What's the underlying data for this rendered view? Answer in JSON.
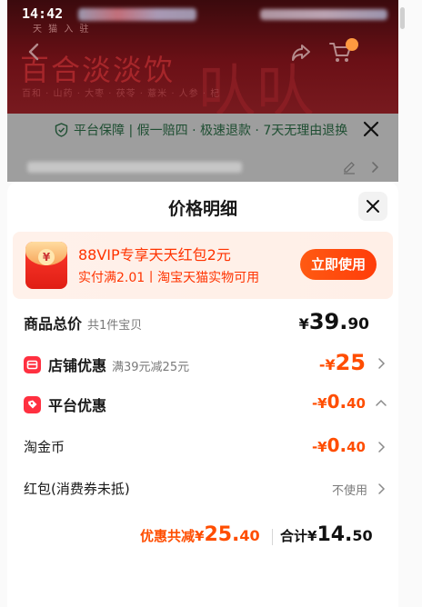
{
  "status_bar": {
    "time": "14:42"
  },
  "background": {
    "title": "百合淡淡饮",
    "top_text": "天 猫 入 驻",
    "subtitle": "百和 · 山药 · 大枣 · 茯苓 · 薏米 · 人参 · 杞",
    "guarantee_text": "平台保障 | 假一赔四 · 极速退款 · 7天无理由退换",
    "colors": {
      "hero": "#6b1016",
      "guarantee_text": "#1e4e32"
    }
  },
  "sheet": {
    "title": "价格明细",
    "promo": {
      "title": "88VIP专享天天红包2元",
      "subtitle": "实付满2.01丨淘宝天猫实物可用",
      "button": "立即使用",
      "icon_symbol": "¥"
    },
    "rows": {
      "total": {
        "label": "商品总价",
        "note": "共1件宝贝",
        "currency": "¥",
        "integer": "39.",
        "decimal": "90"
      },
      "shop_discount": {
        "label": "店铺优惠",
        "note": "满39元减25元",
        "prefix": "-¥",
        "integer": "25"
      },
      "platform_discount": {
        "label": "平台优惠",
        "prefix": "-¥",
        "integer": "0.",
        "decimal": "40"
      },
      "taojinbi": {
        "label": "淘金币",
        "prefix": "-¥",
        "integer": "0.",
        "decimal": "40"
      },
      "hongbao": {
        "label": "红包(消费券未抵)",
        "value": "不使用"
      }
    },
    "summary": {
      "discount_label": "优惠共减¥",
      "discount_integer": "25.",
      "discount_decimal": "40",
      "total_label": "合计¥",
      "total_integer": "14.",
      "total_decimal": "50"
    }
  },
  "colors": {
    "accent_orange": "#ff4d00",
    "badge_red": "#ff3040",
    "promo_red": "#ff3300"
  }
}
